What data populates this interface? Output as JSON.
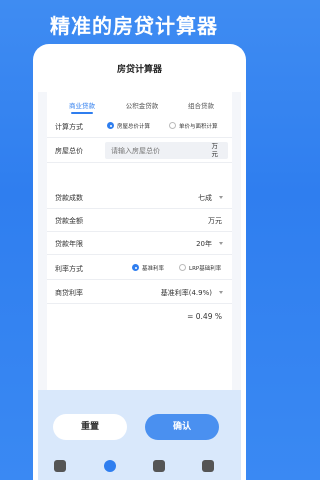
{
  "promo": {
    "title": "精准的房贷计算器"
  },
  "header": {
    "title": "房贷计算器"
  },
  "tabs": [
    {
      "label": "商业贷款",
      "active": true
    },
    {
      "label": "公积金贷款",
      "active": false
    },
    {
      "label": "组合贷款",
      "active": false
    }
  ],
  "form": {
    "calc_method": {
      "label": "计算方式",
      "options": [
        "房屋总价计算",
        "单价与面积计算"
      ],
      "selected": "房屋总价计算"
    },
    "house_price": {
      "label": "房屋总价",
      "placeholder": "请输入房屋总价",
      "unit": "万元"
    },
    "loan_ratio": {
      "label": "贷款成数",
      "value": "七成"
    },
    "loan_amount": {
      "label": "贷款金额",
      "unit": "万元"
    },
    "loan_years": {
      "label": "贷款年限",
      "value": "20年"
    },
    "rate_method": {
      "label": "利率方式",
      "options": [
        "基准利率",
        "LRP基础利率"
      ],
      "selected": "基准利率"
    },
    "commercial_rate": {
      "label": "商贷利率",
      "value": "基准利率(4.9%)"
    },
    "rate_result": {
      "value": "= 0.49 %"
    }
  },
  "buttons": {
    "reset": "重置",
    "confirm": "确认"
  },
  "tabbar": [
    {
      "icon": "camera-icon",
      "active": false
    },
    {
      "icon": "calculator-icon",
      "active": true
    },
    {
      "icon": "chat-icon",
      "active": false
    },
    {
      "icon": "profile-icon",
      "active": false
    }
  ],
  "colors": {
    "accent": "#2f7eef",
    "background": "#3a89f3"
  }
}
